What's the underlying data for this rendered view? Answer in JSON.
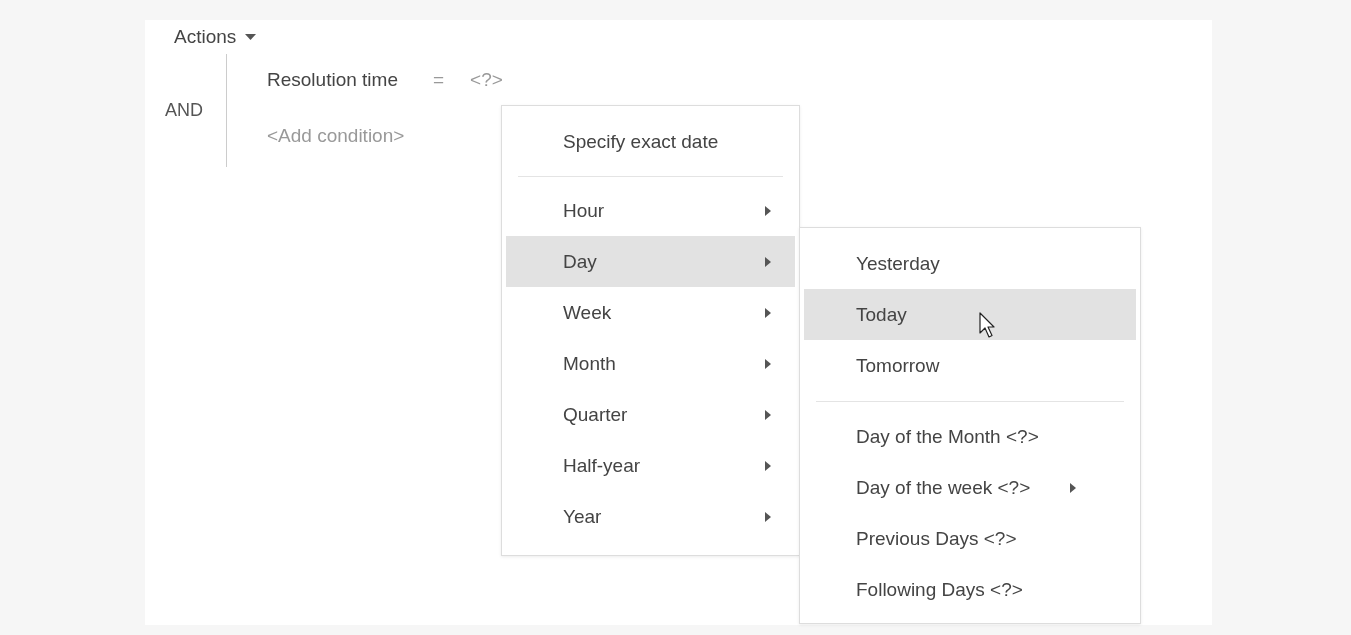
{
  "toolbar": {
    "actions_label": "Actions"
  },
  "condition_group": {
    "operator": "AND",
    "conditions": [
      {
        "field": "Resolution time",
        "operator": "=",
        "value": "<?>"
      }
    ],
    "add_condition": "<Add condition>"
  },
  "date_menu": {
    "items": [
      {
        "kind": "item",
        "label": "Specify exact date",
        "has_submenu": false,
        "selected": false
      },
      {
        "kind": "separator"
      },
      {
        "kind": "item",
        "label": "Hour",
        "has_submenu": true,
        "selected": false
      },
      {
        "kind": "item",
        "label": "Day",
        "has_submenu": true,
        "selected": true
      },
      {
        "kind": "item",
        "label": "Week",
        "has_submenu": true,
        "selected": false
      },
      {
        "kind": "item",
        "label": "Month",
        "has_submenu": true,
        "selected": false
      },
      {
        "kind": "item",
        "label": "Quarter",
        "has_submenu": true,
        "selected": false
      },
      {
        "kind": "item",
        "label": "Half-year",
        "has_submenu": true,
        "selected": false
      },
      {
        "kind": "item",
        "label": "Year",
        "has_submenu": true,
        "selected": false
      }
    ]
  },
  "day_submenu": {
    "items": [
      {
        "kind": "item",
        "label": "Yesterday",
        "has_submenu": false,
        "selected": false
      },
      {
        "kind": "item",
        "label": "Today",
        "has_submenu": false,
        "selected": true
      },
      {
        "kind": "item",
        "label": "Tomorrow",
        "has_submenu": false,
        "selected": false
      },
      {
        "kind": "separator"
      },
      {
        "kind": "item",
        "label": "Day of the Month <?>",
        "has_submenu": false,
        "selected": false
      },
      {
        "kind": "item",
        "label": "Day of the week <?>",
        "has_submenu": true,
        "selected": false
      },
      {
        "kind": "item",
        "label": "Previous Days <?>",
        "has_submenu": false,
        "selected": false
      },
      {
        "kind": "item",
        "label": "Following Days <?>",
        "has_submenu": false,
        "selected": false
      }
    ]
  }
}
